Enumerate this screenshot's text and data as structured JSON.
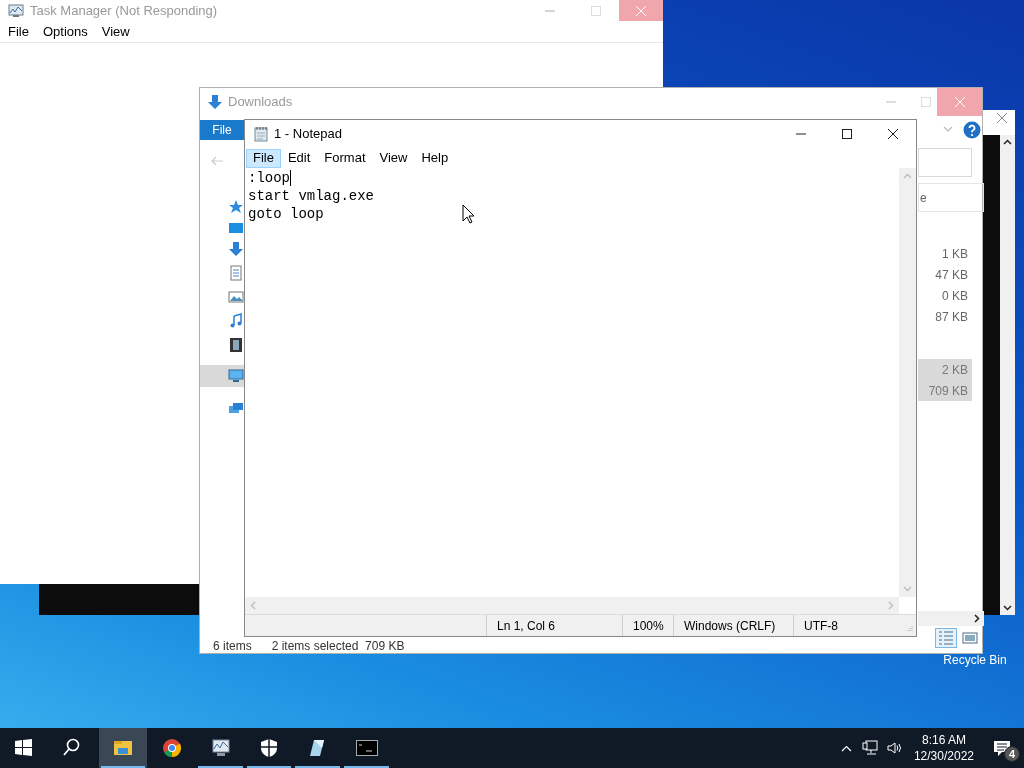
{
  "task_manager": {
    "title": "Task Manager (Not Responding)",
    "menu": [
      "File",
      "Options",
      "View"
    ]
  },
  "explorer": {
    "title": "Downloads",
    "ribbon_tab": "File",
    "column_header": "e",
    "nav_items": [
      {
        "kind": "quick-access",
        "selected": false
      },
      {
        "kind": "desktop",
        "selected": false
      },
      {
        "kind": "downloads",
        "selected": false
      },
      {
        "kind": "documents",
        "selected": false
      },
      {
        "kind": "pictures",
        "selected": false
      },
      {
        "kind": "music",
        "selected": false
      },
      {
        "kind": "videos",
        "selected": false
      },
      {
        "kind": "this-pc",
        "selected": true
      },
      {
        "kind": "network",
        "selected": false
      }
    ],
    "sizes": [
      {
        "text": "1 KB",
        "selected": false
      },
      {
        "text": "47 KB",
        "selected": false
      },
      {
        "text": "0 KB",
        "selected": false
      },
      {
        "text": "87 KB",
        "selected": false
      },
      {
        "text": "2 KB",
        "selected": true
      },
      {
        "text": "709 KB",
        "selected": true
      }
    ],
    "status_bar": {
      "item_count": "6 items",
      "selection": "2 items selected  709 KB"
    },
    "view_buttons": [
      {
        "kind": "details",
        "selected": true
      },
      {
        "kind": "large-icons",
        "selected": false
      }
    ]
  },
  "notepad": {
    "title": "1 - Notepad",
    "menu": [
      {
        "label": "File",
        "selected": true
      },
      {
        "label": "Edit",
        "selected": false
      },
      {
        "label": "Format",
        "selected": false
      },
      {
        "label": "View",
        "selected": false
      },
      {
        "label": "Help",
        "selected": false
      }
    ],
    "lines": [
      ":loop",
      "start vmlag.exe",
      "goto loop"
    ],
    "status_bar": [
      "Ln 1, Col 6",
      "100%",
      "Windows (CRLF)",
      "UTF-8"
    ]
  },
  "desktop_icons": [
    {
      "label": "Recycle Bin"
    }
  ],
  "taskbar": {
    "apps": [
      {
        "kind": "start"
      },
      {
        "kind": "search"
      },
      {
        "kind": "explorer",
        "active": true,
        "running": true
      },
      {
        "kind": "chrome",
        "active": false,
        "running": false
      },
      {
        "kind": "task-manager",
        "active": false,
        "running": true
      },
      {
        "kind": "security",
        "active": false,
        "running": true
      },
      {
        "kind": "notepad",
        "active": false,
        "running": true
      },
      {
        "kind": "terminal",
        "active": false,
        "running": true
      }
    ],
    "clock": {
      "time": "8:16 AM",
      "date": "12/30/2022"
    },
    "notification_count": "4"
  }
}
